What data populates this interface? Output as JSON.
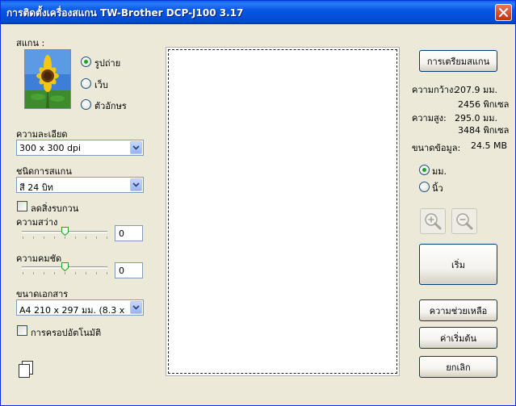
{
  "window": {
    "title": "การติดตั้งเครื่องสแกน TW-Brother DCP-J100 3.17"
  },
  "scan_type": {
    "label": "สแกน :",
    "options": [
      {
        "label": "รูปถ่าย",
        "selected": true
      },
      {
        "label": "เว็บ",
        "selected": false
      },
      {
        "label": "ตัวอักษร",
        "selected": false
      }
    ]
  },
  "resolution": {
    "label": "ความละเอียด",
    "value": "300 x 300 dpi"
  },
  "scan_mode": {
    "label": "ชนิดการสแกน",
    "value": "สี 24 บิท"
  },
  "reduce_noise": {
    "label": "ลดสิ่งรบกวน",
    "checked": false
  },
  "brightness": {
    "label": "ความสว่าง",
    "value": "0"
  },
  "contrast": {
    "label": "ความคมชัด",
    "value": "0"
  },
  "doc_size": {
    "label": "ขนาดเอกสาร",
    "value": "A4 210 x 297 มม. (8.3 x 11"
  },
  "auto_crop": {
    "label": "การครอปอัตโนมัติ",
    "checked": false
  },
  "prescan_button": "การเตรียมสแกน",
  "info": {
    "width_label": "ความกว้าง:",
    "width_mm": "207.9 มม.",
    "width_px": "2456 พิกเซล",
    "height_label": "ความสูง:",
    "height_mm": "295.0 มม.",
    "height_px": "3484 พิกเซล",
    "size_label": "ขนาดข้อมูล:",
    "size_value": "24.5 MB"
  },
  "units": {
    "options": [
      {
        "label": "มม.",
        "selected": true
      },
      {
        "label": "นิ้ว",
        "selected": false
      }
    ]
  },
  "icons": {
    "zoom_in": "zoom-in-icon",
    "zoom_out": "zoom-out-icon",
    "copy": "copy-pages-icon",
    "close": "close-icon"
  },
  "buttons": {
    "start": "เริ่ม",
    "help": "ความช่วยเหลือ",
    "defaults": "ค่าเริ่มต้น",
    "cancel": "ยกเลิก"
  },
  "colors": {
    "titlebar": "#0054e3",
    "face": "#ece9d8",
    "radio_dot": "#21a121"
  }
}
